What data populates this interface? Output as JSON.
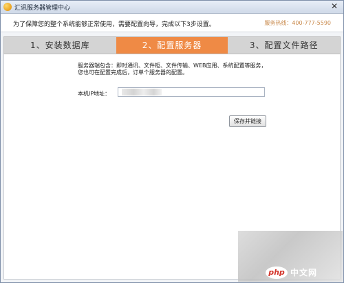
{
  "window": {
    "title": "汇讯服务器管理中心",
    "close_glyph": "✕"
  },
  "notice": {
    "text": "为了保障您的整个系统能够正常使用，需要配置向导，完成以下3步设置。",
    "hotline": "服务热线：400-777-5590"
  },
  "steps": [
    {
      "label": "1、安装数据库",
      "active": false
    },
    {
      "label": "2、配置服务器",
      "active": true
    },
    {
      "label": "3、配置文件路径",
      "active": false
    }
  ],
  "form": {
    "description": "服务器端包含：即时通讯、文件柜、文件传输、WEB应用、系统配置等服务，您也可在配置完成后，订单个服务器的配置。",
    "ip_label": "本机IP地址：",
    "ip_value": "",
    "save_button": "保存并链接"
  },
  "watermark": {
    "logo": "php",
    "text": "中文网"
  },
  "colors": {
    "active_step": "#ef8a45",
    "hotline": "#c8884a"
  }
}
